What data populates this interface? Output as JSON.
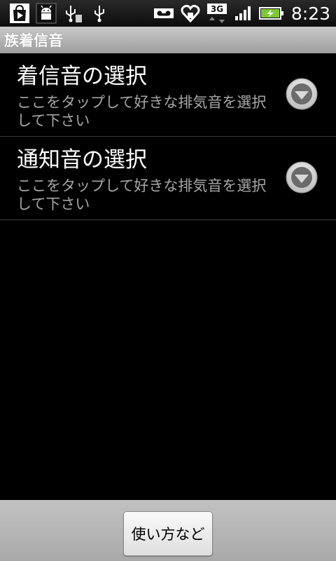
{
  "status_bar": {
    "clock": "8:23",
    "network_label": "3G",
    "left_icons": [
      "play-store-icon",
      "android-icon",
      "usb-debug-icon",
      "usb-icon"
    ],
    "right_icons": [
      "voicemail-icon",
      "heart-icon",
      "network-3g-icon",
      "signal-icon",
      "battery-charging-icon"
    ]
  },
  "title_bar": {
    "title": "族着信音"
  },
  "list": {
    "items": [
      {
        "title": "着信音の選択",
        "summary": "ここをタップして好きな排気音を選択して下さい"
      },
      {
        "title": "通知音の選択",
        "summary": "ここをタップして好きな排気音を選択して下さい"
      }
    ]
  },
  "bottom_bar": {
    "help_label": "使い方など"
  },
  "colors": {
    "title_bar": "#b4b4b4",
    "summary_text": "#a6a6a6",
    "battery": "#7ec832"
  }
}
